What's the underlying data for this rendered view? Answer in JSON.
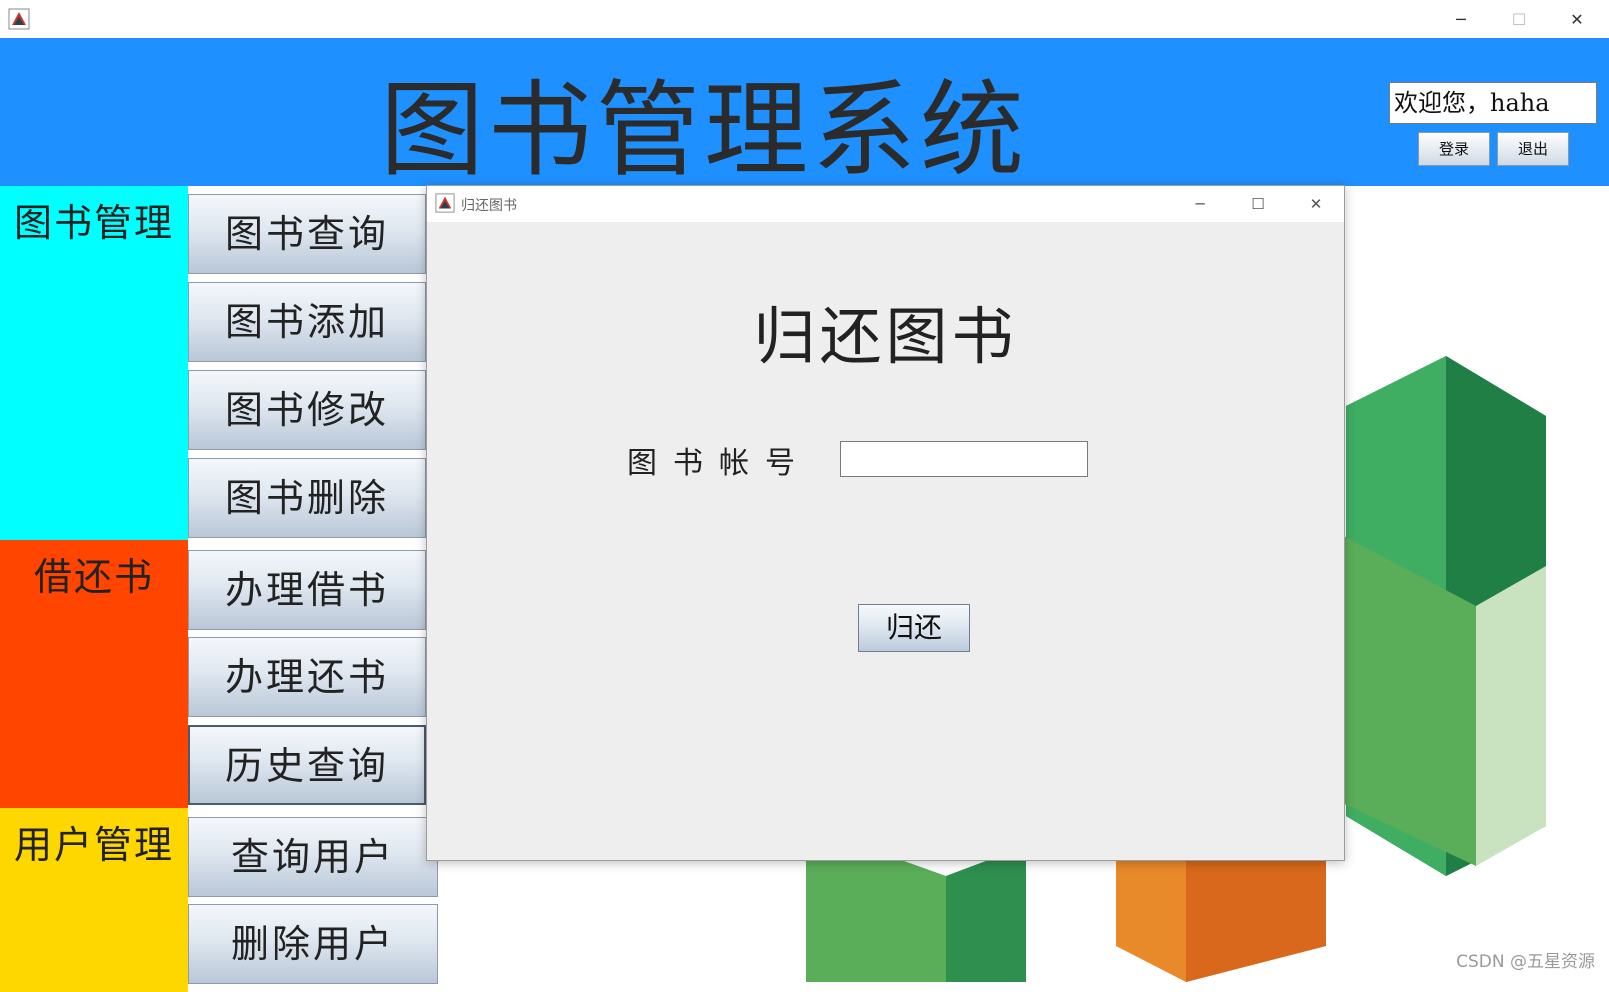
{
  "window": {
    "icon": "java-app-icon",
    "minimize": "─",
    "maximize": "☐",
    "close": "✕"
  },
  "header": {
    "title": "图书管理系统",
    "welcome": "欢迎您，haha",
    "login_label": "登录",
    "logout_label": "退出",
    "background_color": "#1e90ff"
  },
  "sidebar": {
    "categories": [
      {
        "label": "图书管理",
        "color": "#00ffff"
      },
      {
        "label": "借还书",
        "color": "#ff4500"
      },
      {
        "label": "用户管理",
        "color": "#ffd700"
      }
    ],
    "buttons": [
      {
        "label": "图书查询"
      },
      {
        "label": "图书添加"
      },
      {
        "label": "图书修改"
      },
      {
        "label": "图书删除"
      },
      {
        "label": "办理借书"
      },
      {
        "label": "办理还书"
      },
      {
        "label": "历史查询"
      },
      {
        "label": "查询用户"
      },
      {
        "label": "删除用户"
      }
    ]
  },
  "dialog": {
    "title": "归还图书",
    "heading": "归还图书",
    "field_label": "图书帐号",
    "field_value": "",
    "submit_label": "归还",
    "minimize": "─",
    "maximize": "☐",
    "close": "✕"
  },
  "watermark": "CSDN @五星资源"
}
